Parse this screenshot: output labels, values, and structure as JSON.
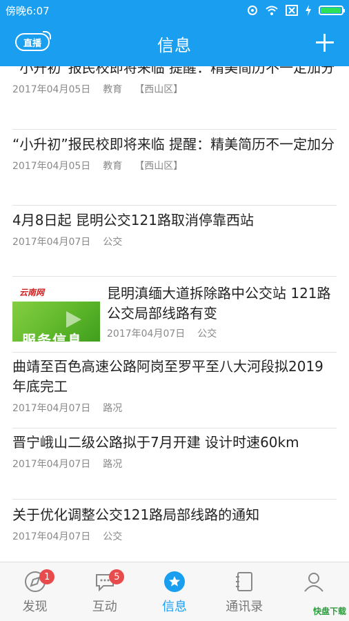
{
  "status_bar": {
    "time": "傍晚6:07"
  },
  "header": {
    "title": "信息",
    "live_label": "直播"
  },
  "news": [
    {
      "title": "“小升初”报民校即将来临 提醒：精美简历不一定加分",
      "date": "2017年04月05日",
      "category": "教育",
      "region": "【西山区】"
    },
    {
      "title": "“小升初”报民校即将来临 提醒：精美简历不一定加分",
      "date": "2017年04月05日",
      "category": "教育",
      "region": "【西山区】"
    },
    {
      "title": "4月8日起 昆明公交121路取消停靠西站",
      "date": "2017年04月07日",
      "category": "公交",
      "region": ""
    },
    {
      "title": "昆明滇缅大道拆除路中公交站 121路公交局部线路有变",
      "date": "2017年04月07日",
      "category": "公交",
      "region": "",
      "thumb_logo": "云南网",
      "thumb_text": "服务信息"
    },
    {
      "title": "曲靖至百色高速公路阿岗至罗平至八大河段拟2019年底完工",
      "date": "2017年04月07日",
      "category": "路况",
      "region": ""
    },
    {
      "title": "晋宁峨山二级公路拟于7月开建 设计时速60km",
      "date": "2017年04月07日",
      "category": "路况",
      "region": ""
    },
    {
      "title": "关于优化调整公交121路局部线路的通知",
      "date": "2017年04月07日",
      "category": "公交",
      "region": ""
    }
  ],
  "tabs": [
    {
      "label": "发现",
      "badge": "1"
    },
    {
      "label": "互动",
      "badge": "5"
    },
    {
      "label": "信息",
      "badge": ""
    },
    {
      "label": "通讯录",
      "badge": ""
    },
    {
      "label": "我",
      "badge": ""
    }
  ],
  "watermark": "快盘下载",
  "colors": {
    "accent": "#1a9ff0",
    "badge": "#e84b4b"
  }
}
